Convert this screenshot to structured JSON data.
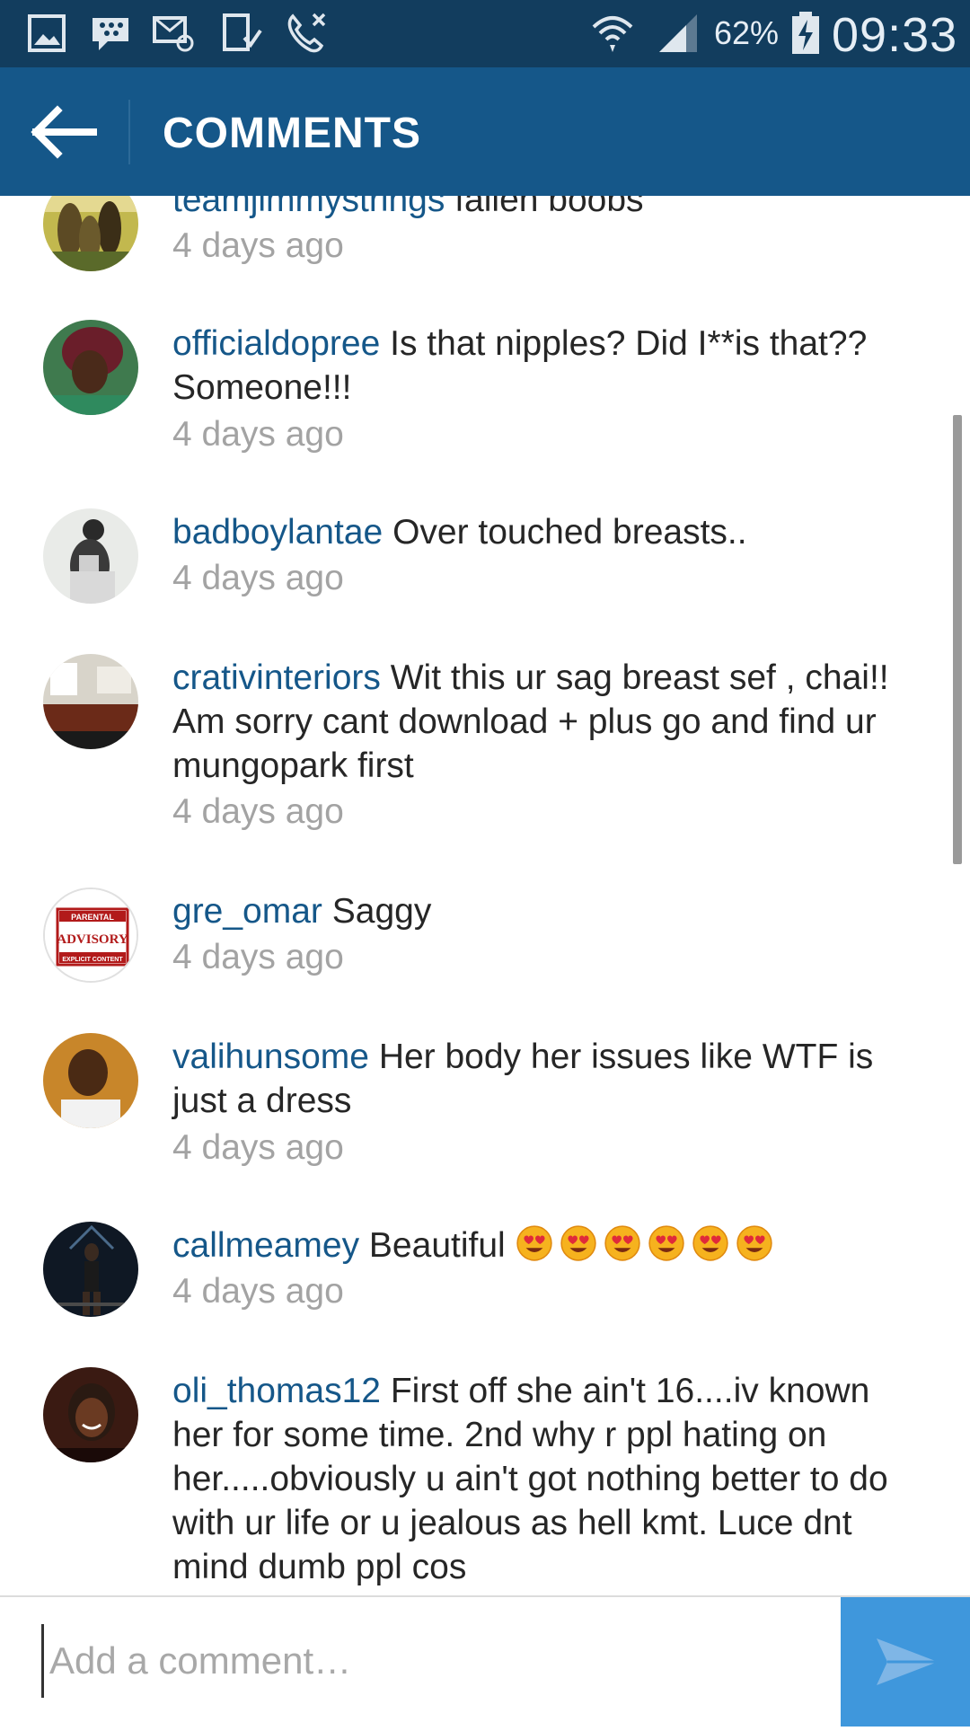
{
  "status_bar": {
    "battery": "62%",
    "time": "09:33"
  },
  "header": {
    "title": "COMMENTS"
  },
  "comments": [
    {
      "username": "teamjimmystrings",
      "text": "fallen boobs",
      "time": "4 days ago"
    },
    {
      "username": "officialdopree",
      "text": "Is that nipples? Did I**is that?? Someone!!!",
      "time": "4 days ago"
    },
    {
      "username": "badboylantae",
      "text": "Over touched breasts..",
      "time": "4 days ago"
    },
    {
      "username": "crativinteriors",
      "text": "Wit this ur sag breast sef , chai!! Am sorry cant download + plus go and find ur mungopark first",
      "time": "4 days ago"
    },
    {
      "username": "gre_omar",
      "text": "Saggy",
      "time": "4 days ago"
    },
    {
      "username": "valihunsome",
      "text": "Her body her issues like WTF is just a dress",
      "time": "4 days ago"
    },
    {
      "username": "callmeamey",
      "text": "Beautiful",
      "time": "4 days ago",
      "emoji_count": 6
    },
    {
      "username": "oli_thomas12",
      "text": "First off she ain't 16....iv known her for some time. 2nd why r ppl hating on her.....obviously u ain't got nothing better to do with ur life or u jealous as hell kmt. Luce dnt mind dumb ppl cos",
      "time": ""
    }
  ],
  "avatar_badge": {
    "line1": "PARENTAL",
    "line2": "ADVISORY",
    "line3": "EXPLICIT CONTENT"
  },
  "input": {
    "placeholder": "Add a comment…"
  },
  "colors": {
    "status_bar": "#123d5e",
    "header": "#155789",
    "username": "#155789",
    "send_button": "#3f97dc"
  },
  "icons": [
    "gallery-icon",
    "bbm-icon",
    "email-icon",
    "download-icon",
    "missed-call-icon",
    "wifi-icon",
    "signal-icon",
    "battery-icon",
    "back-arrow-icon",
    "send-icon",
    "heart-eyes-emoji"
  ]
}
